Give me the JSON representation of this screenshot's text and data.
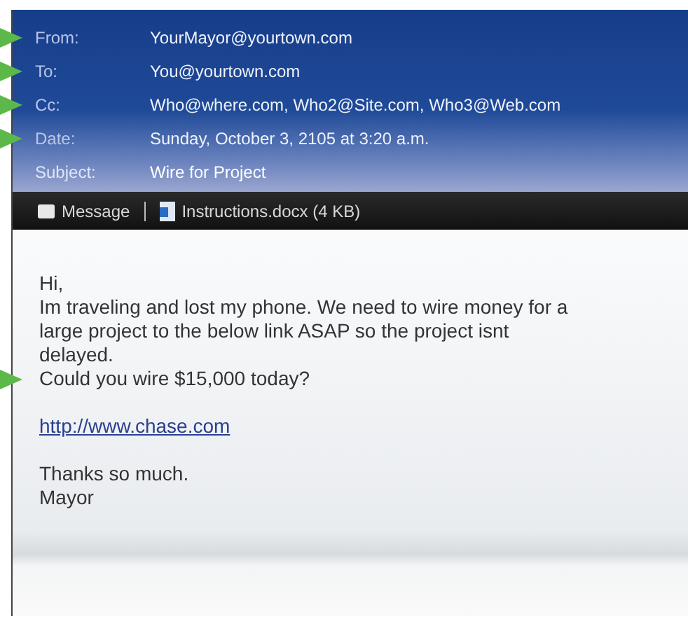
{
  "headers": [
    {
      "label": "From:",
      "value": "YourMayor@yourtown.com",
      "flagged": true
    },
    {
      "label": "To:",
      "value": "You@yourtown.com",
      "flagged": true
    },
    {
      "label": "Cc:",
      "value": "Who@where.com, Who2@Site.com, Who3@Web.com",
      "flagged": true
    },
    {
      "label": "Date:",
      "value": "Sunday, October 3, 2105 at 3:20 a.m.",
      "flagged": true
    },
    {
      "label": "Subject:",
      "value": "Wire for Project",
      "flagged": false
    }
  ],
  "toolbar": {
    "message_tab": "Message",
    "attachment": "Instructions.docx (4 KB)"
  },
  "body": [
    {
      "lines": [
        {
          "kind": "text",
          "text": "Hi,",
          "flagged": false
        },
        {
          "kind": "text",
          "text": "Im traveling and lost my phone. We need to wire money for a large project to the below link ASAP so the project isnt delayed.",
          "flagged": false
        },
        {
          "kind": "text",
          "text": "Could you wire $15,000 today?",
          "flagged": true
        }
      ]
    },
    {
      "lines": [
        {
          "kind": "link",
          "text": "http://www.chase.com",
          "flagged": false
        }
      ]
    },
    {
      "lines": [
        {
          "kind": "text",
          "text": "Thanks so much.",
          "flagged": false
        },
        {
          "kind": "text",
          "text": "Mayor",
          "flagged": false
        }
      ]
    }
  ]
}
